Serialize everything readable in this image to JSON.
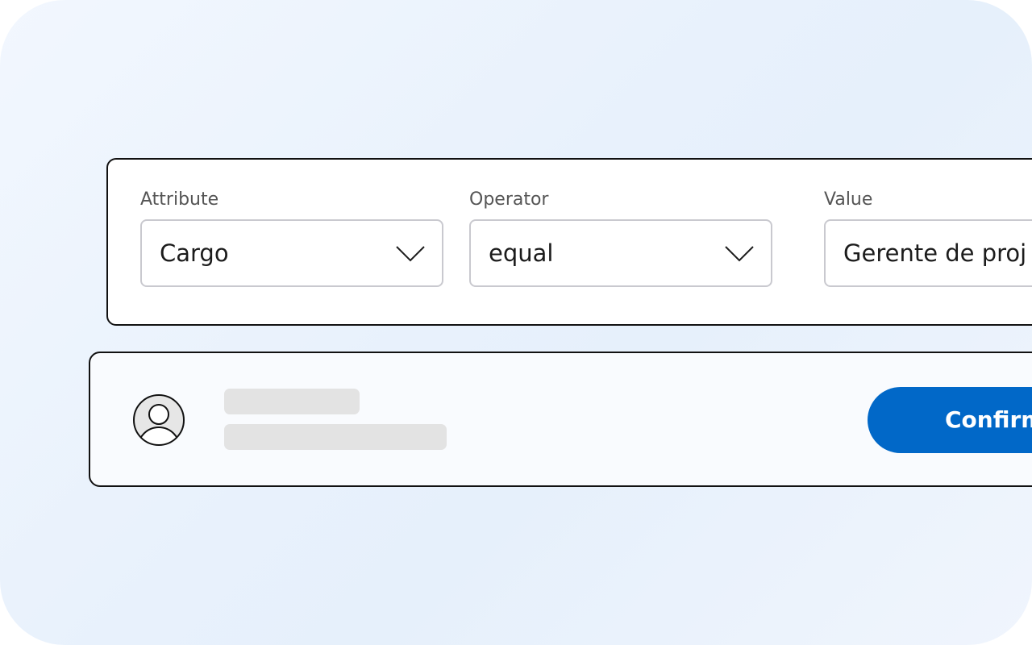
{
  "filter": {
    "attribute": {
      "label": "Attribute",
      "value": "Cargo",
      "icon": "chevron-down-icon"
    },
    "operator": {
      "label": "Operator",
      "value": "equal",
      "icon": "chevron-down-icon"
    },
    "value": {
      "label": "Value",
      "value": "Gerente de proj"
    }
  },
  "user_card": {
    "avatar_icon": "user-avatar-icon",
    "confirm_label": "Confirm"
  },
  "colors": {
    "accent": "#0168c8",
    "skeleton": "#e3e3e3",
    "border": "#111111",
    "input_border": "#c9c9cf"
  }
}
